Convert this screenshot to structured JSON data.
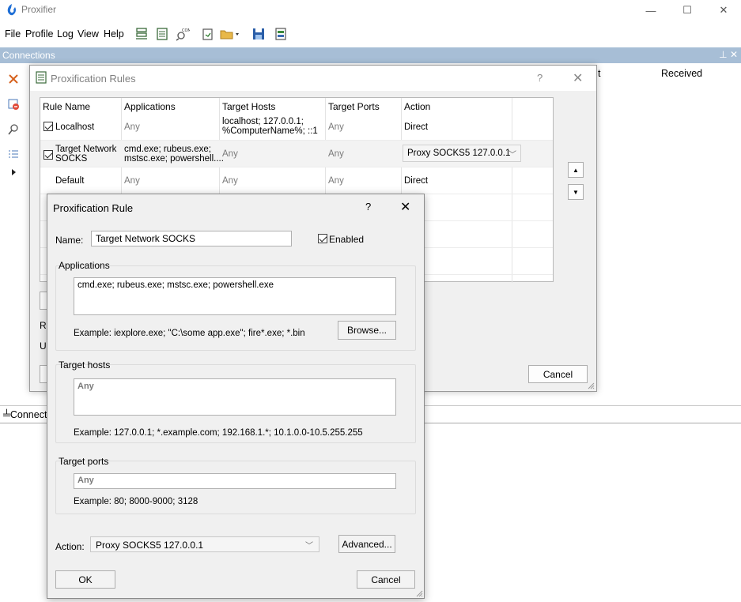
{
  "app": {
    "title": "Proxifier"
  },
  "window_controls": {
    "minimize": "—",
    "maximize": "☐",
    "close": "✕"
  },
  "menu": [
    "File",
    "Profile",
    "Log",
    "View",
    "Help"
  ],
  "connections_panel": {
    "title": "Connections",
    "controls": "⊥ ✕",
    "col_partial": "t",
    "col_received": "Received"
  },
  "bottom_tab": {
    "label": "Connect"
  },
  "rules_dialog": {
    "title": "Proxification Rules",
    "help": "?",
    "close": "✕",
    "columns": [
      "Rule Name",
      "Applications",
      "Target Hosts",
      "Target Ports",
      "Action"
    ],
    "rows": [
      {
        "name": "Localhost",
        "checked": true,
        "apps": "Any",
        "hosts": "localhost; 127.0.0.1;\n%ComputerName%; ::1",
        "ports": "Any",
        "action": "Direct"
      },
      {
        "name": "Target Network\nSOCKS",
        "checked": true,
        "apps": "cmd.exe; rubeus.exe;\nmstsc.exe; powershell....",
        "hosts": "Any",
        "ports": "Any",
        "action": "Proxy SOCKS5 127.0.0.1"
      },
      {
        "name": "Default",
        "checked": false,
        "apps": "Any",
        "hosts": "Any",
        "ports": "Any",
        "action": "Direct"
      }
    ],
    "move_up": "▲",
    "move_down": "▼",
    "partial_label_1": "Ru",
    "partial_label_2": "Us",
    "cancel": "Cancel"
  },
  "rule_dialog": {
    "title": "Proxification Rule",
    "help": "?",
    "close": "✕",
    "name_label": "Name:",
    "name_value": "Target Network SOCKS",
    "enabled_label": "Enabled",
    "applications": {
      "label": "Applications",
      "value": "cmd.exe; rubeus.exe; mstsc.exe; powershell.exe",
      "example": "Example: iexplore.exe; \"C:\\some app.exe\"; fire*.exe; *.bin",
      "browse": "Browse..."
    },
    "target_hosts": {
      "label": "Target hosts",
      "value": "Any",
      "example": "Example: 127.0.0.1; *.example.com; 192.168.1.*; 10.1.0.0-10.5.255.255"
    },
    "target_ports": {
      "label": "Target ports",
      "value": "Any",
      "example": "Example: 80; 8000-9000; 3128"
    },
    "action_label": "Action:",
    "action_value": "Proxy SOCKS5 127.0.0.1",
    "advanced": "Advanced...",
    "ok": "OK",
    "cancel": "Cancel"
  },
  "colors": {
    "accent_bar": "#a7bed6",
    "dialog_bg": "#f0f0f0",
    "logo": "#1f6fd6",
    "toolbar_icon": "#3b6b3b"
  }
}
